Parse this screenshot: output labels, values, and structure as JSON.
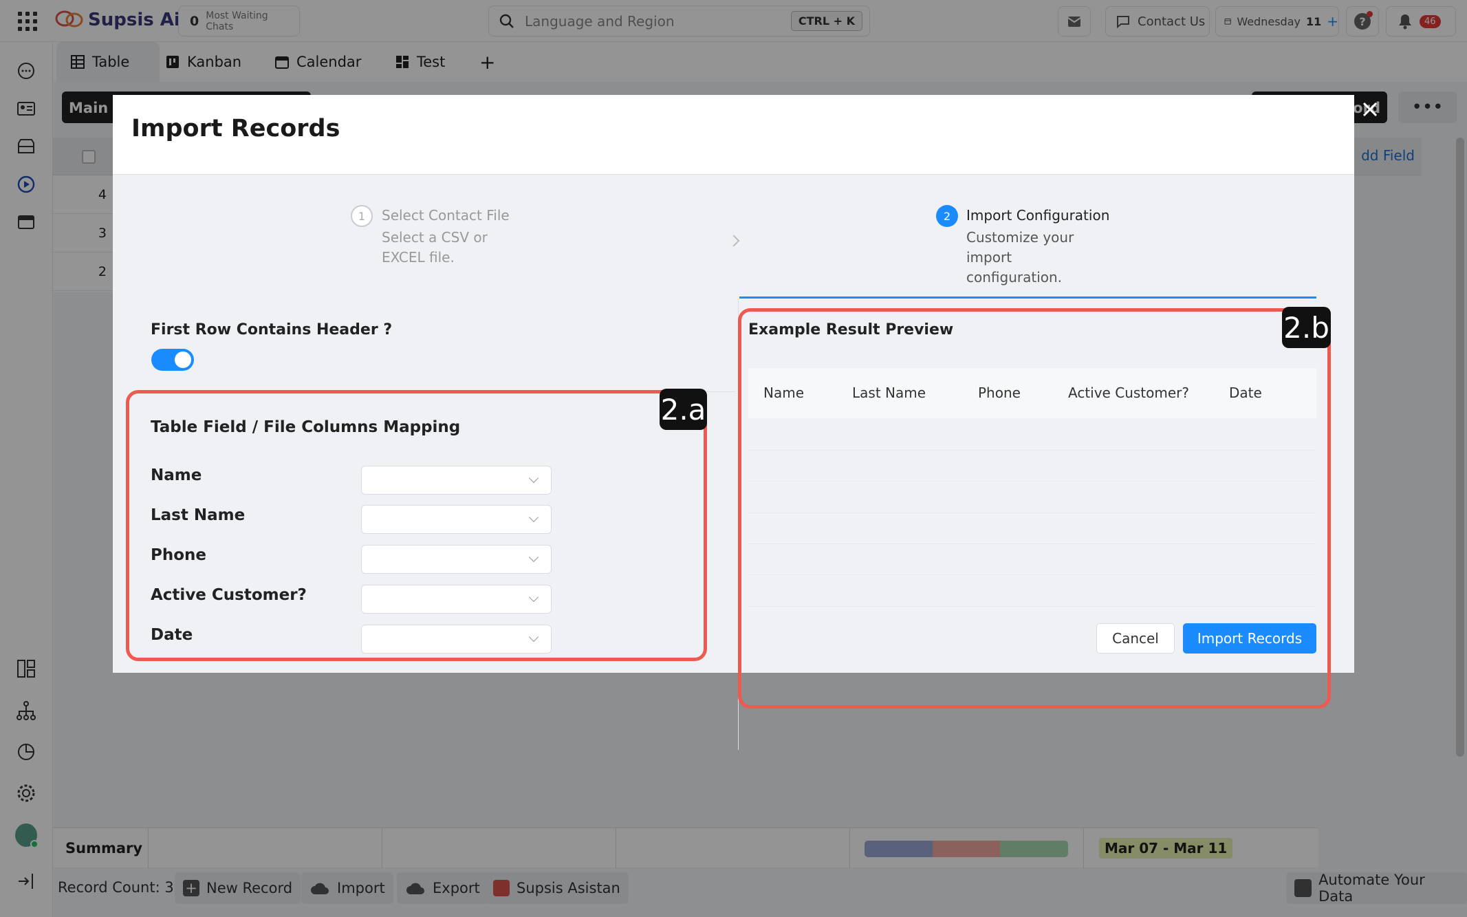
{
  "topbar": {
    "brand": "Supsis Ai",
    "waiting_count": "0",
    "waiting_label": "Most Waiting Chats",
    "search_placeholder": "Language and Region",
    "shortcut": "CTRL + K",
    "contact_label": "Contact Us",
    "day_label": "Wednesday",
    "day_num": "11",
    "notif_count": "46"
  },
  "tabs": [
    {
      "label": "Table"
    },
    {
      "label": "Kanban"
    },
    {
      "label": "Calendar"
    },
    {
      "label": "Test"
    }
  ],
  "background": {
    "main_table_label": "Main T",
    "add_record_label": "cord",
    "add_field_label": "dd Field",
    "row_ids": [
      "4",
      "3",
      "2"
    ],
    "summary_label": "Summary",
    "date_range": "Mar 07 - Mar 11",
    "record_count": "Record Count: 3",
    "new_record": "New Record",
    "import": "Import",
    "export": "Export",
    "assistant": "Supsis Asistan",
    "automate": "Automate Your Data"
  },
  "modal": {
    "title": "Import Records",
    "step1": {
      "num": "1",
      "title": "Select Contact File",
      "desc": "Select a CSV or EXCEL file."
    },
    "step2": {
      "num": "2",
      "title": "Import Configuration",
      "desc": "Customize your import configuration."
    },
    "header_toggle_label": "First Row Contains Header ?",
    "header_toggle_on": true,
    "mapping_title": "Table Field / File Columns Mapping",
    "fields": [
      "Name",
      "Last Name",
      "Phone",
      "Active Customer?",
      "Date"
    ],
    "preview_title": "Example Result Preview",
    "preview_columns": [
      "Name",
      "Last Name",
      "Phone",
      "Active Customer?",
      "Date"
    ],
    "cancel": "Cancel",
    "import": "Import Records"
  },
  "annotations": {
    "a": "2.a",
    "b": "2.b"
  },
  "colors": {
    "primary": "#1a8cff",
    "annotation": "#ef5a50",
    "brand": "#d9534f"
  }
}
